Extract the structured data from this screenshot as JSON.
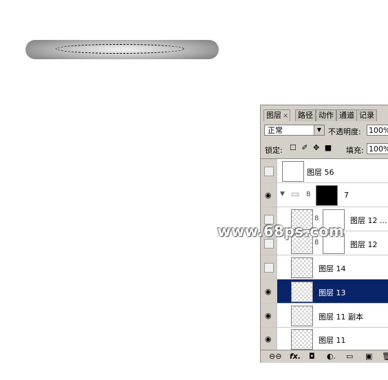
{
  "panel": {
    "tabs": {
      "layers": "图层",
      "paths": "路径",
      "actions": "动作",
      "channels": "通道",
      "history": "记录"
    },
    "close_glyph": "×",
    "blend_mode": "正常",
    "opacity_label": "不透明度:",
    "opacity_value": "100%",
    "lock_label": "锁定:",
    "lock_icons": "☐ ✐ ✥ ■",
    "fill_label": "填充:",
    "fill_value": "100%"
  },
  "layers": [
    {
      "name": "图层 56",
      "visible": false
    },
    {
      "name": "7",
      "visible": true,
      "type": "group"
    },
    {
      "name": "图层 12 ...",
      "visible": false
    },
    {
      "name": "图层 12",
      "visible": false
    },
    {
      "name": "图层 14",
      "visible": false
    },
    {
      "name": "图层 13",
      "visible": true,
      "selected": true
    },
    {
      "name": "图层 11 副本",
      "visible": true
    },
    {
      "name": "图层 11",
      "visible": true
    }
  ],
  "footer": {
    "link": "⊖⊖",
    "fx": "fx.",
    "mask": "◘",
    "adjust": "◐.",
    "group": "▭",
    "new": "▣",
    "delete": "🗑"
  },
  "watermark": "www.68ps.com",
  "colors": {
    "selection": "#0a246a",
    "panel": "#d4d0c8"
  }
}
